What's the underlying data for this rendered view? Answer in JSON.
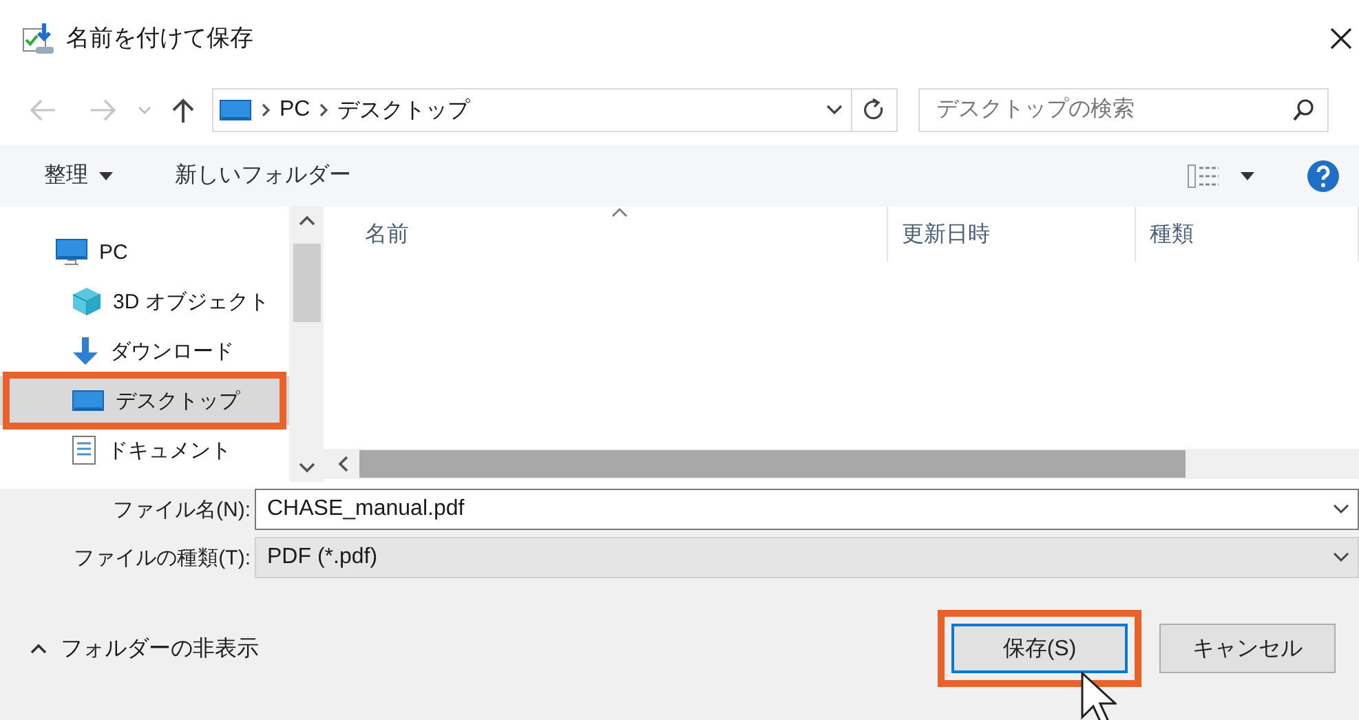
{
  "window": {
    "title": "名前を付けて保存"
  },
  "address_bar": {
    "path": [
      "PC",
      "デスクトップ"
    ]
  },
  "search": {
    "placeholder": "デスクトップの検索"
  },
  "toolbar": {
    "organize": "整理",
    "new_folder": "新しいフォルダー"
  },
  "sidebar": {
    "items": [
      {
        "label": "PC",
        "kind": "pc",
        "selected": false,
        "annotated": false,
        "children": [
          {
            "label": "3D オブジェクト",
            "kind": "cube",
            "selected": false,
            "annotated": false
          },
          {
            "label": "ダウンロード",
            "kind": "download",
            "selected": false,
            "annotated": false
          },
          {
            "label": "デスクトップ",
            "kind": "desktop",
            "selected": true,
            "annotated": true
          },
          {
            "label": "ドキュメント",
            "kind": "document",
            "selected": false,
            "annotated": false
          }
        ]
      }
    ]
  },
  "file_list": {
    "columns": [
      {
        "label": "名前",
        "sorted": true
      },
      {
        "label": "更新日時",
        "sorted": false
      },
      {
        "label": "種類",
        "sorted": false
      }
    ]
  },
  "file_name": {
    "label": "ファイル名(N):",
    "value": "CHASE_manual.pdf"
  },
  "file_type": {
    "label": "ファイルの種類(T):",
    "value": "PDF (*.pdf)"
  },
  "hide_folders": {
    "label": "フォルダーの非表示"
  },
  "buttons": [
    {
      "label": "保存(S)",
      "default": true,
      "annotated": true
    },
    {
      "label": "キャンセル",
      "default": false,
      "annotated": false
    }
  ]
}
